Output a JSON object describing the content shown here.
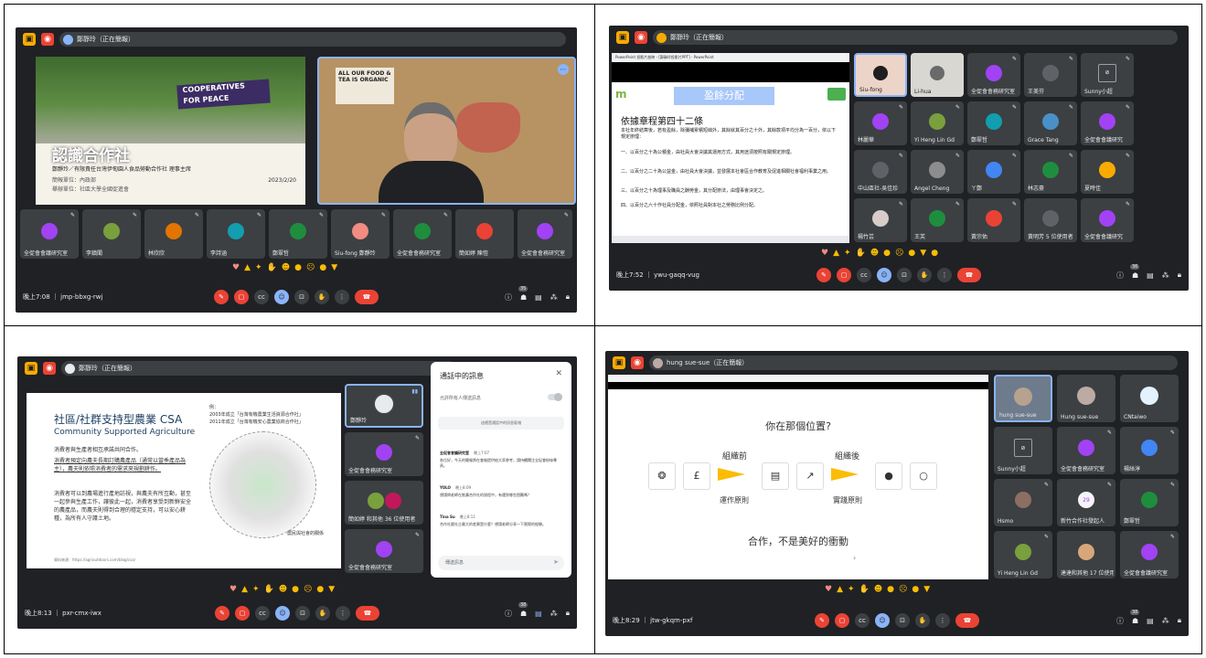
{
  "p1": {
    "presenter": "鄭靜玲（正在簡報）",
    "slide": {
      "banner_line1": "COOPERATIVES",
      "banner_line2": "FOR PEACE",
      "title": "認識合作社",
      "line1": "鄭靜玲／有限責任台灣伊甸園人食品勞動合作社 理事主席",
      "line2": "簡報單位：內政部",
      "line3": "舉辦單位：社區大學全國促進會",
      "date": "2023/2/20"
    },
    "video_poster": "ALL OUR FOOD & TEA IS ORGANIC",
    "tiles": [
      "全促會會議研究室",
      "李鎮聞",
      "林欣欣",
      "李詩涵",
      "鄭翠哲",
      "Siu-fong 鄭靜玲",
      "全促會會務研究室",
      "簡如婷 陳愷",
      "全促會會務研究室"
    ],
    "tile_avatars": [
      "",
      "",
      "Y",
      "",
      "",
      "",
      "",
      "",
      ""
    ],
    "meeting": "晚上7:08 ｜ jmp-bbxg-rwj",
    "people_count": "35"
  },
  "p2": {
    "presenter": "鄭靜玲（正在簡報）",
    "browser_title": "PowerPoint 投影片放映 - [鄭靜玲投影片PPT] - PowerPoint",
    "slide": {
      "header": "盈餘分配",
      "title": "依據章程第四十二條",
      "b1": "本社年終結算後，若有盈餘，除彌補累積短絀外，其餘就其百分之十外，其餘款項平均分為一百分，依以下規定辦理：",
      "b2": "一、以百分之十為公積金，由社員大會決議其運用方式，其用途須按照有關規定辦理。",
      "b3": "二、以百分之二十為公益金，由社員大會決議，並發展本社會區合作教育及促進相關社會福利事業之用。",
      "b4": "三、以百分之十為理事及職員之酬勞金，其分配辦法，由理事會決定之。",
      "b5": "四、以百分之六十作社員分配金，依照社員對本社之勞務比例分配。"
    },
    "tiles": [
      "Siu-fong",
      "Li-hua",
      "全促會會務研究室",
      "王美芬",
      "Sunny小超",
      "林麗華",
      "Yi Heng Lin Gd",
      "鄭翠哲",
      "Grace Tang",
      "全促會會議研究",
      "中山區社-吳佳珍",
      "Angel Cheng",
      "ㄚ鄭",
      "林志豪",
      "夏時佳",
      "楊竹芸",
      "王芙",
      "黃宗佑",
      "黃明芳 5 位使用者",
      "全促會會議研究"
    ],
    "reaction_extra": "●",
    "meeting": "晚上7:52 ｜ ywu-gaqq-vug",
    "people_count": "36"
  },
  "p3": {
    "presenter": "鄭靜玲（正在簡報）",
    "slide": {
      "title": "社區/社群支持型農業 CSA",
      "subtitle": "Community Supported Agriculture",
      "note1": "例：",
      "note2": "2003年成立「台灣有機農業生活資源合作社」",
      "note3": "2011年成立「台灣有機安心農業協商合作社」",
      "p1": "消費者與生產者相互承諾共同合作。",
      "p2": "消費者預定向農夫長期訂購農產品（通常以當季產品為主），農夫則依照消費者的需求來規劃耕作。",
      "p3": "消費者可以到農場進行產地訪視，與農夫有所互動，甚至一起參與生產工作，讓彼此一起，消費者享受到新鮮安全的農產品，而農夫則得到合理的穩定支持，可以安心耕種，為所有人守護土地。",
      "source": "資料來源：https://agrioutdoors.com/blog/csa/",
      "map_label": "農民與社會的關係"
    },
    "tiles": [
      "鄭靜玲",
      "全促會會務研究室",
      "簡如婷 和其他 36 位使用者",
      "全促會會務研究室"
    ],
    "chat": {
      "title": "通話中的訊息",
      "toggle": "允許所有人傳送訊息",
      "notice": "這裡是通話中的訊息區塊",
      "m1_name": "全促會會議研究室",
      "m1_time": "晚上7:07",
      "m1_text": "各位好，今天的簡報將在會後提供給大家參考，請持續關注全促會粉絲專頁。",
      "m2_name": "YOLO",
      "m2_time": "晚上8:09",
      "m2_text": "想請問老師在推廣合作社的過程中，有遇到哪些困難嗎？",
      "m3_name": "Tina Su",
      "m3_time": "晚上8:11",
      "m3_text": "合作社跟社企最大的差異是什麼？想請老師分享一下實際的經驗。",
      "input": "傳送訊息"
    },
    "meeting": "晚上8:13 ｜ pxr-cmx-iwx",
    "people_count": "38"
  },
  "p4": {
    "presenter": "hung sue-sue（正在簡報）",
    "slide": {
      "title": "你在那個位置?",
      "label_left": "組織前",
      "label_right": "組織後",
      "under_left": "運作原則",
      "under_right": "實踐原則",
      "tagline": "合作，不是美好的衝動"
    },
    "tiles": [
      "hung sue-sue",
      "Hung sue-sue",
      "CNtaiwo",
      "Sunny小超",
      "全促會會務研究室",
      "楊絲淳",
      "Hsmo",
      "新竹合作社發起人",
      "鄭翠哲",
      "Yi Heng Lin Gd",
      "達達和其他 17 位使用者",
      "全促會會議研究室"
    ],
    "meeting": "晚上8:29 ｜ jtw-gkqm-pxf",
    "people_count": "38"
  }
}
